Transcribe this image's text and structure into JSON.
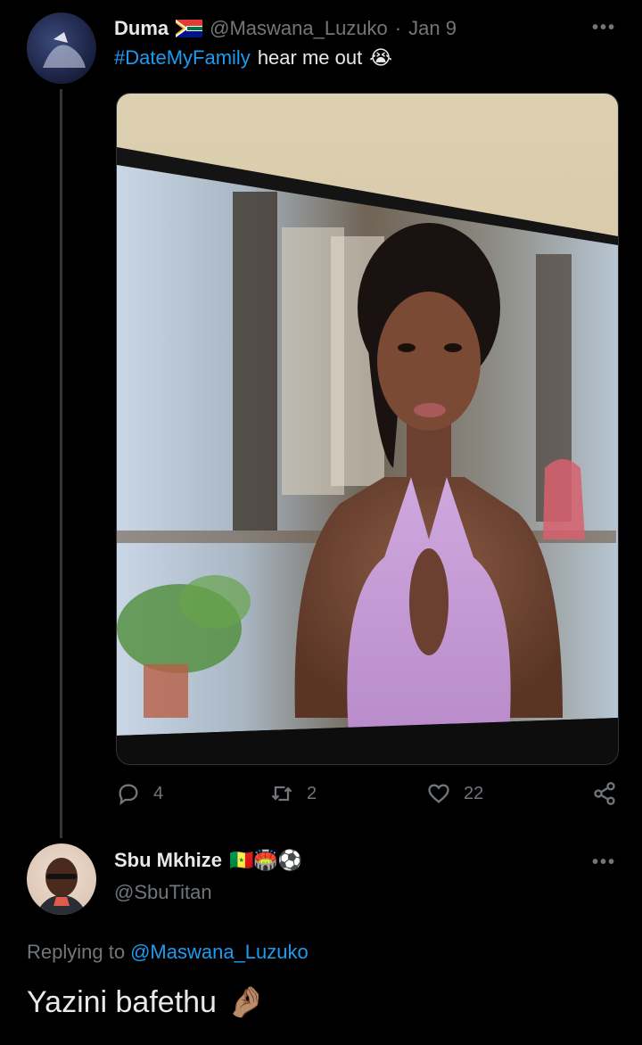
{
  "tweet": {
    "author_name": "Duma",
    "author_handle": "@Maswana_Luzuko",
    "separator": "·",
    "date": "Jan 9",
    "hashtag": "#DateMyFamily",
    "text": "hear me out",
    "emoji": "😭",
    "more": "•••",
    "actions": {
      "replies": "4",
      "retweets": "2",
      "likes": "22"
    }
  },
  "reply": {
    "author_name": "Sbu Mkhize",
    "author_emojis": "🇸🇳🏟️⚽",
    "author_handle": "@SbuTitan",
    "more": "•••",
    "replying_prefix": "Replying to",
    "replying_to": "@Maswana_Luzuko",
    "text": "Yazini bafethu",
    "emoji": "🤌🏽"
  },
  "colors": {
    "background": "#000000",
    "text": "#e7e9ea",
    "muted": "#71767b",
    "link": "#1d9bf0"
  },
  "icons": [
    "reply-icon",
    "retweet-icon",
    "like-icon",
    "share-icon",
    "more-icon",
    "south-africa-flag-icon"
  ]
}
